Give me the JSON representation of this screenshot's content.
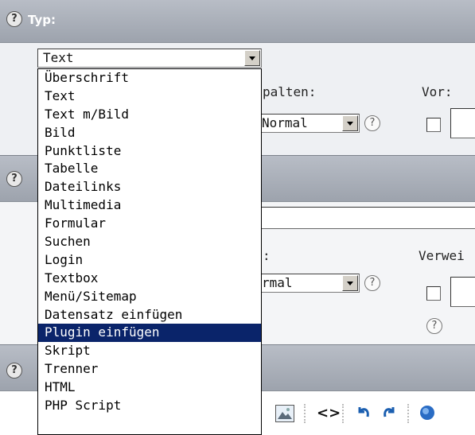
{
  "type_section": {
    "title": "Typ:",
    "help_symbol": "?",
    "selected_type": "Text"
  },
  "row1": {
    "columns_label": "palten:",
    "columns_value": "Normal",
    "before_label": "Vor:",
    "help_symbol": "?"
  },
  "row2": {
    "label_partial": ":",
    "value_partial": "rmal",
    "link_label": "Verwei",
    "help_symbol": "?"
  },
  "type_options": [
    "Überschrift",
    "Text",
    "Text m/Bild",
    "Bild",
    "Punktliste",
    "Tabelle",
    "Dateilinks",
    "Multimedia",
    "Formular",
    "Suchen",
    "Login",
    "Textbox",
    "Menü/Sitemap",
    "Datensatz einfügen",
    "Plugin einfügen",
    "Skript",
    "Trenner",
    "HTML",
    "PHP Script"
  ],
  "highlighted_option": "Plugin einfügen",
  "toolbar": {
    "image_icon": "image-icon",
    "source_icon": "code-brackets-icon",
    "source_glyph": "<>",
    "undo_icon": "undo-icon",
    "redo_icon": "redo-icon"
  },
  "colors": {
    "header_bg": "#a9aeb7",
    "row_bg": "#eef0f3",
    "highlight": "#0a246a"
  }
}
